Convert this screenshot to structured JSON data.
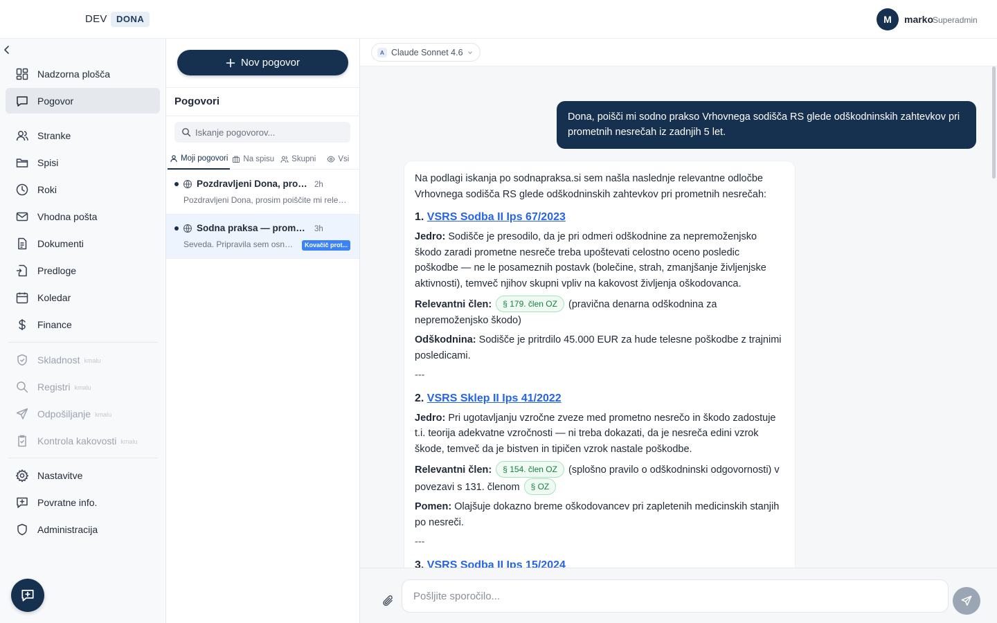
{
  "topbar": {
    "env_label": "DEV",
    "env_badge": "DONA",
    "user": {
      "initial": "M",
      "name": "marko",
      "role": "Superadmin"
    }
  },
  "sidebar": {
    "collapse_icon": "chevron-left-icon",
    "items": [
      {
        "label": "Nadzorna plošča",
        "icon": "dashboard-icon"
      },
      {
        "label": "Pogovor",
        "icon": "chat-icon",
        "active": true
      },
      {
        "label": "Stranke",
        "icon": "users-icon"
      },
      {
        "label": "Spisi",
        "icon": "folder-icon"
      },
      {
        "label": "Roki",
        "icon": "clock-icon"
      },
      {
        "label": "Vhodna pošta",
        "icon": "mail-icon"
      },
      {
        "label": "Dokumenti",
        "icon": "document-icon"
      },
      {
        "label": "Predloge",
        "icon": "template-icon"
      },
      {
        "label": "Koledar",
        "icon": "calendar-icon"
      },
      {
        "label": "Finance",
        "icon": "dollar-icon"
      }
    ],
    "soon_items": [
      {
        "label": "Skladnost",
        "soon": "kmalu",
        "icon": "shield-check-icon"
      },
      {
        "label": "Registri",
        "soon": "kmalu",
        "icon": "search-icon"
      },
      {
        "label": "Odpošiljanje",
        "soon": "kmalu",
        "icon": "send-icon"
      },
      {
        "label": "Kontrola kakovosti",
        "soon": "kmalu",
        "icon": "clipboard-check-icon"
      }
    ],
    "bottom_items": [
      {
        "label": "Nastavitve",
        "icon": "gear-icon"
      },
      {
        "label": "Povratne info.",
        "icon": "feedback-icon"
      },
      {
        "label": "Administracija",
        "icon": "shield-icon"
      }
    ]
  },
  "conversations": {
    "new_button": "Nov pogovor",
    "title": "Pogovori",
    "search_placeholder": "Iskanje pogovorov...",
    "tabs": [
      {
        "label": "Moji pogovori",
        "active": true
      },
      {
        "label": "Na spisu"
      },
      {
        "label": "Skupni"
      },
      {
        "label": "Vsi"
      }
    ],
    "items": [
      {
        "title": "Pozdravljeni Dona, prosim poiščite mi relevantno sodno prakso",
        "time": "2h",
        "preview": "Pozdravljeni Dona, prosim poiščite mi relevantno sodno prakso",
        "tag": ""
      },
      {
        "title": "Sodna praksa — prometne nesreče",
        "time": "3h",
        "preview": "Seveda. Pripravila sem osnutek",
        "tag": "Kovačič prot...",
        "selected": true
      }
    ]
  },
  "chat": {
    "model": {
      "badge": "A",
      "name": "Claude Sonnet 4.6"
    },
    "user_message": "Dona, poišči mi sodno prakso Vrhovnega sodišča RS glede odškodninskih zahtevkov pri prometnih nesrečah iz zadnjih 5 let.",
    "assistant": {
      "intro": "Na podlagi iskanja po sodnapraksa.si sem našla naslednje relevantne odločbe Vrhovnega sodišča RS glede odškodninskih zahtevkov pri prometnih nesrečah:",
      "cases": [
        {
          "num": "1.",
          "title": "VSRS Sodba II Ips 67/2023",
          "core_label": "Jedro:",
          "core": "Sodišče je presodilo, da je pri odmeri odškodnine za nepremoženjsko škodo zaradi prometne nesreče treba upoštevati celostno oceno posledic poškodbe — ne le posameznih postavk (bolečine, strah, zmanjšanje življenjske aktivnosti), temveč njihov skupni vpliv na kakovost življenja oškodovanca.",
          "article_label": "Relevantni člen:",
          "article_chip": "§ 179. člen OZ",
          "article_text": "(pravična denarna odškodnina za nepremoženjsko škodo)",
          "extra_label": "Odškodnina:",
          "extra": "Sodišče je pritrdilo 45.000 EUR za hude telesne poškodbe z trajnimi posledicami."
        },
        {
          "num": "2.",
          "title": "VSRS Sklep II Ips 41/2022",
          "core_label": "Jedro:",
          "core": "Pri ugotavljanju vzročne zveze med prometno nesrečo in škodo zadostuje t.i. teorija adekvatne vzročnosti — ni treba dokazati, da je nesreča edini vzrok škode, temveč da je bistven in tipičen vzrok nastale poškodbe.",
          "article_label": "Relevantni člen:",
          "article_chip": "§ 154. člen OZ",
          "article_text": "(splošno pravilo o odškodninski odgovornosti) v povezavi s 131. členom",
          "article_chip2": "§ OZ",
          "extra_label": "Pomen:",
          "extra": "Olajšuje dokazno breme oškodovancev pri zapletenih medicinskih stanjih po nesreči."
        },
        {
          "num": "3.",
          "title": "VSRS Sodba II Ips 15/2024"
        }
      ],
      "separator": "---"
    },
    "input_placeholder": "Pošljite sporočilo..."
  },
  "colors": {
    "primary": "#16304f",
    "link": "#2563eb",
    "chip_green": "#15803d",
    "tag_blue": "#3b82f6"
  }
}
